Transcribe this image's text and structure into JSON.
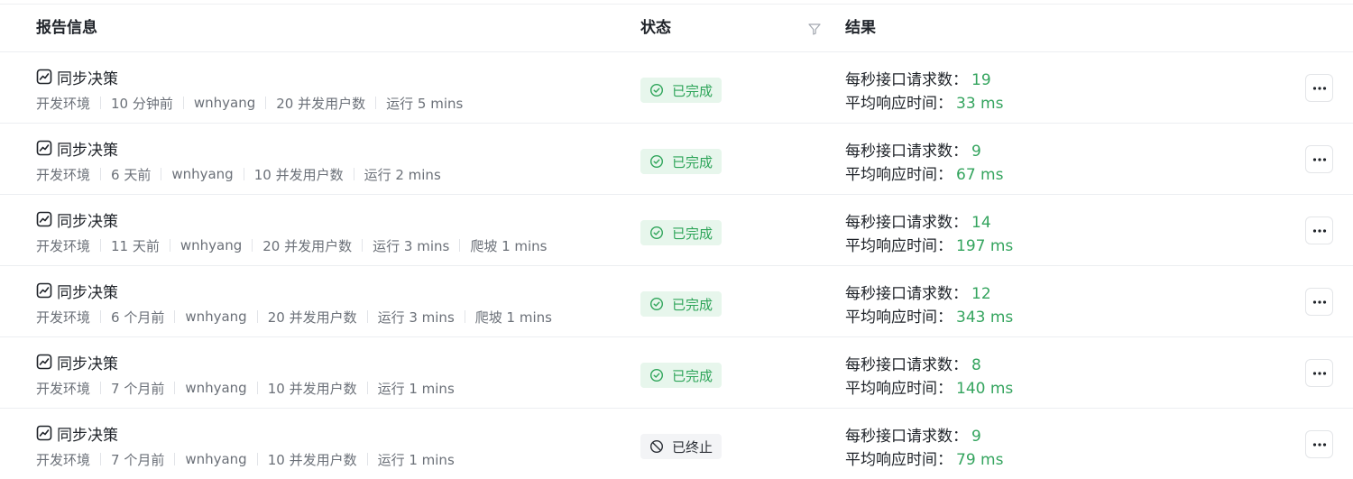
{
  "header": {
    "report_info": "报告信息",
    "status": "状态",
    "result": "结果",
    "filter_icon": "filter-icon"
  },
  "labels": {
    "rps": "每秒接口请求数：",
    "avg_resp": "平均响应时间："
  },
  "colors": {
    "success": "#2fa55a",
    "success_bg": "#e7f6ec",
    "value": "#34a45e",
    "stopped_bg": "#f3f4f6"
  },
  "rows": [
    {
      "title": "同步决策",
      "meta": [
        "开发环境",
        "10 分钟前",
        "wnhyang",
        "20 并发用户数",
        "运行 5 mins"
      ],
      "status": "已完成",
      "status_type": "done",
      "rps": "19",
      "avg_resp": "33 ms"
    },
    {
      "title": "同步决策",
      "meta": [
        "开发环境",
        "6 天前",
        "wnhyang",
        "10 并发用户数",
        "运行 2 mins"
      ],
      "status": "已完成",
      "status_type": "done",
      "rps": "9",
      "avg_resp": "67 ms"
    },
    {
      "title": "同步决策",
      "meta": [
        "开发环境",
        "11 天前",
        "wnhyang",
        "20 并发用户数",
        "运行 3 mins",
        "爬坡 1 mins"
      ],
      "status": "已完成",
      "status_type": "done",
      "rps": "14",
      "avg_resp": "197 ms"
    },
    {
      "title": "同步决策",
      "meta": [
        "开发环境",
        "6 个月前",
        "wnhyang",
        "20 并发用户数",
        "运行 3 mins",
        "爬坡 1 mins"
      ],
      "status": "已完成",
      "status_type": "done",
      "rps": "12",
      "avg_resp": "343 ms"
    },
    {
      "title": "同步决策",
      "meta": [
        "开发环境",
        "7 个月前",
        "wnhyang",
        "10 并发用户数",
        "运行 1 mins"
      ],
      "status": "已完成",
      "status_type": "done",
      "rps": "8",
      "avg_resp": "140 ms"
    },
    {
      "title": "同步决策",
      "meta": [
        "开发环境",
        "7 个月前",
        "wnhyang",
        "10 并发用户数",
        "运行 1 mins"
      ],
      "status": "已终止",
      "status_type": "stopped",
      "rps": "9",
      "avg_resp": "79 ms"
    }
  ]
}
